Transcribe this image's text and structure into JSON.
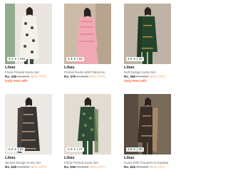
{
  "products": [
    {
      "rating": "4.1",
      "reviews": "240",
      "brand": "Libas",
      "title": "Floral Printed Kurta Set",
      "price": "Rs. 339",
      "mrp": "Rs.6999",
      "discount": "(68% OFF)",
      "stock": "Only Few Left!",
      "colors": {
        "bg": "#e9e4df",
        "dress": "#f4f1ec",
        "pattern": "#3b4a3a",
        "skin": "#d9a98a"
      }
    },
    {
      "rating": "4.3",
      "reviews": "63",
      "brand": "Libas",
      "title": "Printed Kurta With Palazzos",
      "price": "Rs. 379",
      "mrp": "Rs.6999",
      "discount": "(68% OFF)",
      "stock": "",
      "colors": {
        "bg": "#cbbba6",
        "dress": "#f0a9b4",
        "pattern": "#e98b9c",
        "skin": "#c9977a"
      }
    },
    {
      "rating": "4.3",
      "reviews": "12",
      "brand": "Libas",
      "title": "Self Design Kurta Set",
      "price": "Rs. 369",
      "mrp": "Rs.6999",
      "discount": "(68% OFF)",
      "stock": "Only Few Left!",
      "colors": {
        "bg": "#bfb3a5",
        "dress": "#24452c",
        "pattern": "#b58c3a",
        "skin": "#c98e6e"
      }
    },
    {
      "rating": "5.0",
      "reviews": "47",
      "brand": "Libas",
      "title": "Woven Design Kurta Set",
      "price": "Rs. 525",
      "mrp": "Rs.6999",
      "discount": "(65% OFF)",
      "stock": "",
      "colors": {
        "bg": "#ece8e4",
        "dress": "#3a3433",
        "pattern": "#b59a78",
        "skin": "#d3a284"
      }
    },
    {
      "rating": "4.0",
      "reviews": "47",
      "brand": "Libas",
      "title": "Floral Printed Kurta Set",
      "price": "Rs. 525",
      "mrp": "Rs.6420",
      "discount": "(65% OFF)",
      "stock": "",
      "colors": {
        "bg": "#e3dcd2",
        "dress": "#2f4a36",
        "pattern": "#6a8a55",
        "skin": "#c98e6e"
      }
    },
    {
      "rating": "3.9",
      "reviews": "30",
      "brand": "Libas",
      "title": "Kurta With Trousers & Dupatta",
      "price": "Rs. 525",
      "mrp": "Rs.6420",
      "discount": "(65% OFF)",
      "stock": "",
      "colors": {
        "bg": "#7a6a5a",
        "dress": "#3a2f26",
        "pattern": "#a7876a",
        "skin": "#c98e6e"
      }
    }
  ],
  "rating_separator": "|",
  "star_glyph": "★"
}
